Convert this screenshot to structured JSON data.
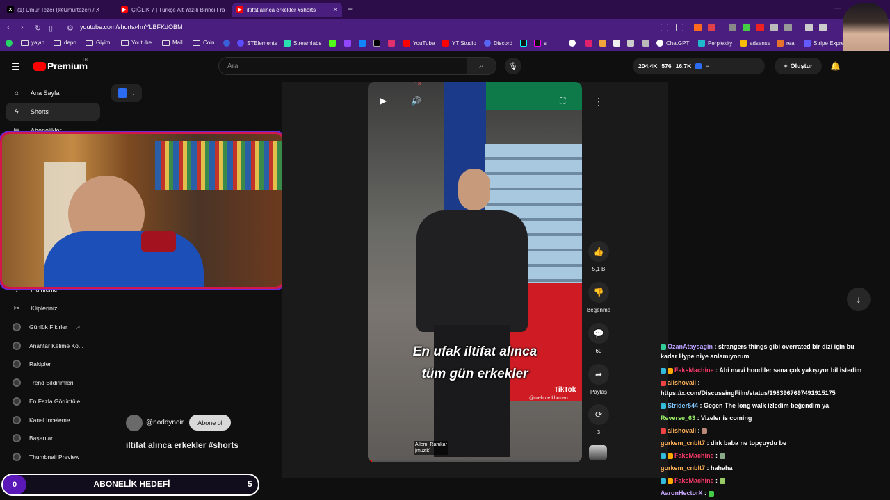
{
  "tabs": [
    {
      "label": "(1) Umur Tezer (@Umurtezer) / X",
      "icon": "x-icon"
    },
    {
      "label": "ÇIĞLIK 7 | Türkçe Alt Yazılı Birinci Fra",
      "icon": "youtube-icon"
    },
    {
      "label": "iltifat alınca erkekler #shorts",
      "icon": "youtube-icon"
    }
  ],
  "address": {
    "url": "youtube.com/shorts/4mYLBFKdOBM"
  },
  "bookmarks": [
    "yayın",
    "depo",
    "Giyim",
    "Youtube",
    "Mail",
    "Coin",
    "STElements",
    "Streamlabs",
    "YouTube",
    "YT Studio",
    "Discord",
    "s",
    "ChatGPT",
    "Perplexity",
    "adsense",
    "real",
    "Stripe Expre"
  ],
  "header": {
    "brand": "Premium",
    "brand_sup": "TR",
    "search_placeholder": "Ara",
    "stats": [
      "204.4K",
      "576",
      "16.7K"
    ],
    "create_label": "Oluştur"
  },
  "sidebar": {
    "items": [
      "Ana Sayfa",
      "Shorts",
      "Abonelikler"
    ],
    "items2": [
      "İndirilenler",
      "Klipleriniz"
    ],
    "tools": [
      "Günlük Fikirler",
      "Anahtar Kelime Ko...",
      "Rakipler",
      "Trend Bildirimleri",
      "En Fazla Görüntüle...",
      "Kanal Inceleme",
      "Başarılar",
      "Thumbnail Preview"
    ]
  },
  "short": {
    "top_number": "13",
    "caption_line1": "En ufak iltifat alınca",
    "caption_line2": "tüm gün erkekler",
    "tiktok": "TikTok",
    "tiktok_handle": "@mehmetkhrman",
    "music": "Ailem, Ramkar\n[müzik]",
    "channel": "@noddynoir",
    "subscribe": "Abone ol",
    "title": "iltifat alınca erkekler #shorts"
  },
  "actions": {
    "likes": "5,1 B",
    "dislike": "Beğenme",
    "comments": "60",
    "share": "Paylaş",
    "remix": "3"
  },
  "chat": [
    {
      "user": "OzanAtaysagin",
      "color": "#b9a0ff",
      "text": ": strangers things gibi overrated bir dizi için bu"
    },
    {
      "user": "",
      "color": "#fff",
      "text": "kadar Hype niye anlamıyorum"
    },
    {
      "user": "FaksMachine",
      "color": "#ff3b6b",
      "text": ": Abi mavi hoodiler sana çok yakışıyor bil istedim"
    },
    {
      "user": "alishovali",
      "color": "#ffb25a",
      "text": ":"
    },
    {
      "user": "",
      "color": "#fff",
      "text": "https://x.com/DiscussingFilm/status/1983967697491915175"
    },
    {
      "user": "Strider544",
      "color": "#7fc8ff",
      "text": ": Geçen The long walk izledim beğendim ya"
    },
    {
      "user": "Reverse_63",
      "color": "#9cf26b",
      "text": ": Vizeler is coming"
    },
    {
      "user": "alishovali",
      "color": "#ffb25a",
      "text": ":"
    },
    {
      "user": "gorkem_cnblt7",
      "color": "#ffb25a",
      "text": ": dirk baba ne topçuydu be"
    },
    {
      "user": "FaksMachine",
      "color": "#ff3b6b",
      "text": ":"
    },
    {
      "user": "gorkem_cnblt7",
      "color": "#ffb25a",
      "text": ": hahaha"
    },
    {
      "user": "FaksMachine",
      "color": "#ff3b6b",
      "text": ":"
    },
    {
      "user": "AaronHectorX",
      "color": "#c8a8ff",
      "text": ":"
    }
  ],
  "goal": {
    "left": "0",
    "label": "ABONELİK HEDEFİ",
    "right": "5"
  }
}
